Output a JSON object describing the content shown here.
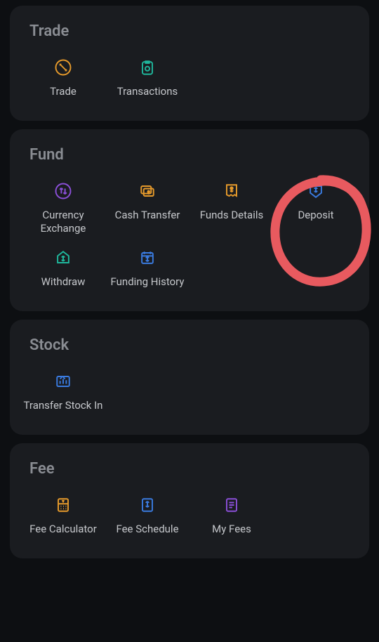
{
  "sections": {
    "trade": {
      "title": "Trade",
      "items": [
        {
          "label": "Trade"
        },
        {
          "label": "Transactions"
        }
      ]
    },
    "fund": {
      "title": "Fund",
      "items": [
        {
          "label": "Currency Exchange"
        },
        {
          "label": "Cash Transfer"
        },
        {
          "label": "Funds Details"
        },
        {
          "label": "Deposit"
        },
        {
          "label": "Withdraw"
        },
        {
          "label": "Funding History"
        }
      ]
    },
    "stock": {
      "title": "Stock",
      "items": [
        {
          "label": "Transfer Stock In"
        }
      ]
    },
    "fee": {
      "title": "Fee",
      "items": [
        {
          "label": "Fee Calculator"
        },
        {
          "label": "Fee Schedule"
        },
        {
          "label": "My Fees"
        }
      ]
    }
  }
}
